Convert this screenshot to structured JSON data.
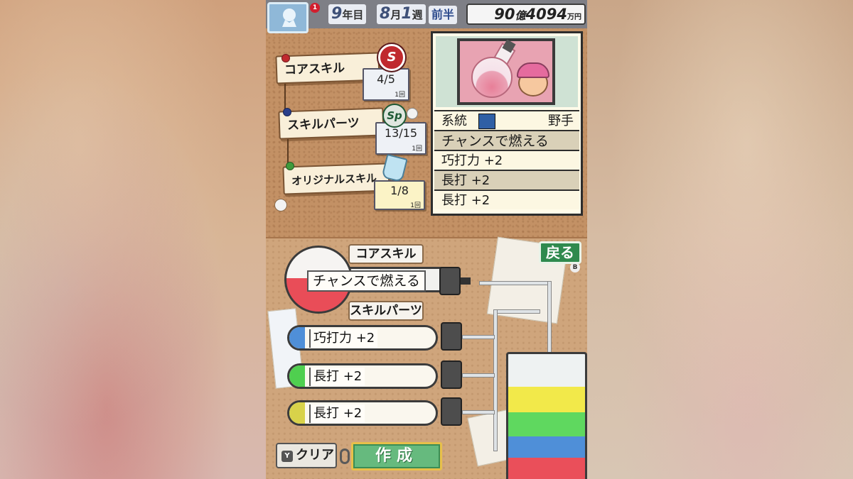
{
  "header": {
    "alert_count": "1",
    "year_num": "9",
    "year_unit": "年目",
    "month_num": "8",
    "month_unit": "月",
    "week_num": "1",
    "week_unit": "週",
    "half": "前半",
    "money_oku": "90",
    "money_oku_unit": "億",
    "money_man": "4094",
    "money_man_unit": "万円"
  },
  "skill_notes": [
    {
      "label": "コアスキル",
      "count": "4/5",
      "sub": "1回",
      "sticker": "S",
      "pin_color": "#c0292e"
    },
    {
      "label": "スキルパーツ",
      "count": "13/15",
      "sub": "1回",
      "sticker": "Sp",
      "pin_color": "#2a3f8a"
    },
    {
      "label": "オリジナルスキル",
      "count": "1/8",
      "sub": "1回",
      "sticker": "",
      "pin_color": "#3f9b3c"
    }
  ],
  "detail": {
    "lineage_label": "系統",
    "position": "野手",
    "rows": [
      "チャンスで燃える",
      "巧打力 +2",
      "長打 +2",
      "長打 +2"
    ]
  },
  "bottom": {
    "back_label": "戻る",
    "back_key": "B",
    "core_section": "コアスキル",
    "core_value": "チャンスで燃える",
    "parts_section": "スキルパーツ",
    "parts": [
      {
        "label": "巧打力 +2",
        "color": "#4f8fd8"
      },
      {
        "label": "長打 +2",
        "color": "#4fcf4f"
      },
      {
        "label": "長打 +2",
        "color": "#d8d24a"
      }
    ],
    "clear_key": "Y",
    "clear_label": "クリア",
    "create_label": "作成"
  },
  "colors": {
    "beaker_layers": [
      "#f2e94a",
      "#5fd85f",
      "#4f8fd8",
      "#ea4f5a"
    ]
  }
}
